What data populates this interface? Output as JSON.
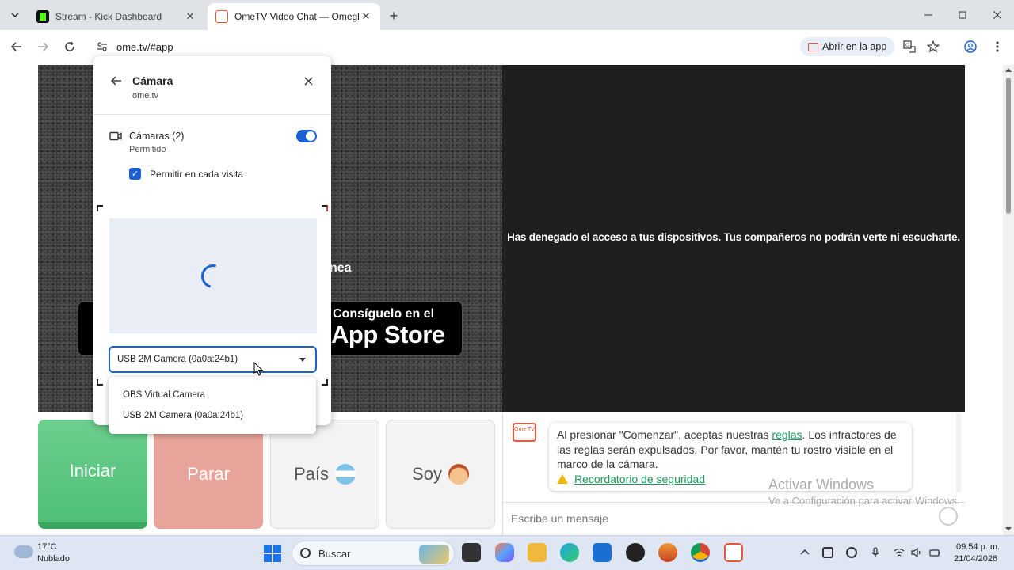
{
  "browser": {
    "tabs": [
      {
        "title": "Stream - Kick Dashboard",
        "active": false,
        "favicon_color": "#53fc18"
      },
      {
        "title": "OmeTV Video Chat — Omegle",
        "active": true,
        "favicon_color": "#e25a3b"
      }
    ],
    "url": "ome.tv/#app",
    "open_in_app_label": "Abrir en la app",
    "icons": [
      "tab-search-icon",
      "back-icon",
      "forward-icon",
      "reload-icon",
      "site-info-icon",
      "translate-icon",
      "star-icon",
      "profile-icon",
      "menu-icon",
      "minimize-icon",
      "maximize-icon",
      "close-icon"
    ]
  },
  "permission_popup": {
    "title": "Cámara",
    "site": "ome.tv",
    "cameras_label": "Cámaras (2)",
    "cameras_status": "Permitido",
    "toggle_on": true,
    "allow_each_visit_label": "Permitir en cada visita",
    "allow_each_visit_checked": true,
    "selected_camera": "USB 2M Camera (0a0a:24b1)",
    "camera_options": [
      "OBS Virtual Camera",
      "USB 2M Camera (0a0a:24b1)"
    ],
    "accent_color": "#1a61d6"
  },
  "page": {
    "partial_text": "nea",
    "appstore_small": "Consíguelo en el",
    "appstore_big": "App Store",
    "denied_message": "Has denegado el acceso a tus dispositivos. Tus compañeros no podrán verte ni escucharte.",
    "buttons": {
      "start": "Iniciar",
      "stop": "Parar",
      "country": "País",
      "gender": "Soy"
    },
    "chat": {
      "logo_text": "Ome TV",
      "message_part1": "Al presionar \"Comenzar\", aceptas nuestras ",
      "rules_link": "reglas",
      "message_part2": ". Los infractores de las reglas serán expulsados. Por favor, mantén tu rostro visible en el marco de la cámara.",
      "safety_link": "Recordatorio de seguridad",
      "input_placeholder": "Escribe un mensaje"
    },
    "colors": {
      "start_button": "#4fbf77",
      "stop_button": "#e8a49a",
      "link_green": "#1b9a5a"
    }
  },
  "windows_watermark": {
    "title": "Activar Windows",
    "subtitle": "Ve a Configuración para activar Windows."
  },
  "taskbar": {
    "weather_temp": "17°C",
    "weather_desc": "Nublado",
    "search_label": "Buscar",
    "time": "09:54 p. m.",
    "date": "21/04/2026"
  }
}
